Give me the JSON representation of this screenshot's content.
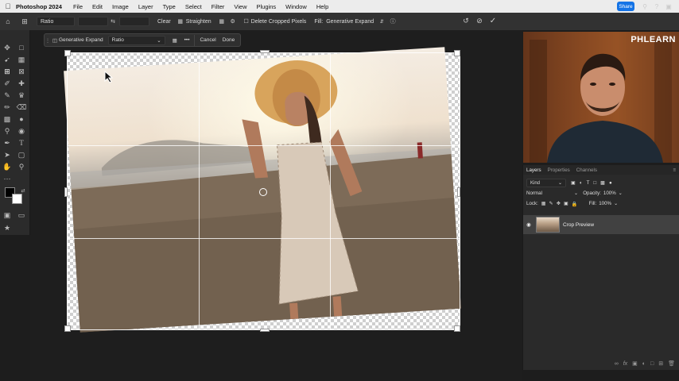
{
  "menubar": {
    "app_name": "Photoshop 2024",
    "items": [
      "File",
      "Edit",
      "Image",
      "Layer",
      "Type",
      "Select",
      "Filter",
      "View",
      "Plugins",
      "Window",
      "Help"
    ]
  },
  "options": {
    "ratio_label": "Ratio",
    "clear_label": "Clear",
    "straighten_label": "Straighten",
    "delete_cropped_label": "Delete Cropped Pixels",
    "fill_label": "Fill:",
    "fill_value": "Generative Expand",
    "share_label": "Share"
  },
  "context_bar": {
    "mode_label": "Generative Expand",
    "ratio_label": "Ratio",
    "more_label": "•••",
    "cancel_label": "Cancel",
    "done_label": "Done"
  },
  "video": {
    "watermark": "PHLEARN"
  },
  "layers_panel": {
    "tabs": [
      "Layers",
      "Properties",
      "Channels"
    ],
    "filter_kind": "Kind",
    "blend_mode": "Normal",
    "opacity_label": "Opacity:",
    "opacity_value": "100%",
    "lock_label": "Lock:",
    "fill_label": "Fill:",
    "fill_value": "100%",
    "layer_name": "Crop Preview"
  },
  "colors": {
    "accent": "#1473e6",
    "canvas_bg": "#1e1e1e",
    "panel_bg": "#2a2a2a"
  }
}
